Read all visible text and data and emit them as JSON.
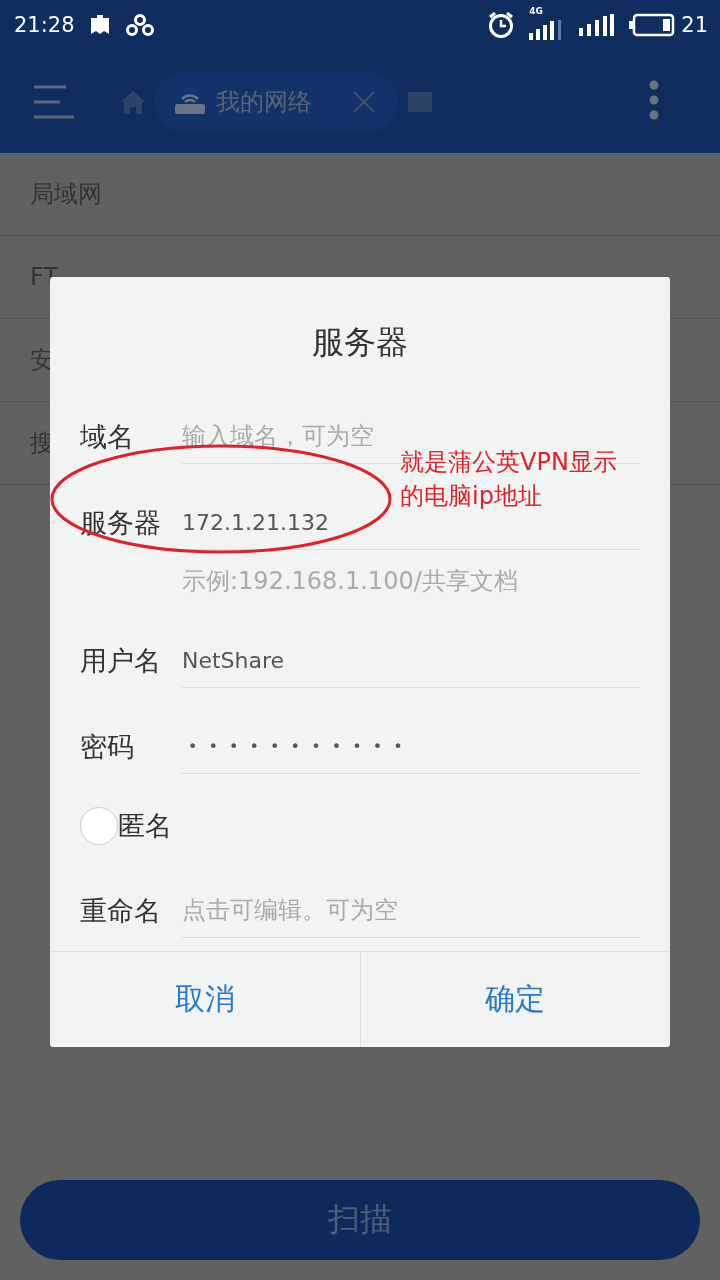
{
  "status_bar": {
    "time": "21:28",
    "network": "4G",
    "battery": "21"
  },
  "toolbar": {
    "tab": {
      "label": "我的网络"
    }
  },
  "list": [
    {
      "label": "局域网"
    },
    {
      "label": "FT"
    },
    {
      "label": "安"
    },
    {
      "label": "搜"
    }
  ],
  "dialog": {
    "title": "服务器",
    "rows": [
      {
        "kind": "text",
        "label": "域名",
        "placeholder": "输入域名，可为空"
      },
      {
        "kind": "text",
        "label": "服务器",
        "value": "172.1.21.132"
      },
      {
        "kind": "hint",
        "text": "示例:192.168.1.100/共享文档"
      },
      {
        "kind": "text",
        "label": "用户名",
        "value": "NetShare"
      },
      {
        "kind": "password",
        "label": "密码",
        "value": "• • • • • • • • • • •"
      },
      {
        "kind": "radio",
        "label": "匿名",
        "checked": false
      },
      {
        "kind": "text",
        "label": "重命名",
        "placeholder": "点击可编辑。可为空"
      }
    ],
    "buttons": [
      "取消",
      "确定"
    ]
  },
  "annotation": {
    "lines": [
      "就是蒲公英VPN显示",
      "的电脑ip地址"
    ]
  },
  "scan_button": "扫描"
}
